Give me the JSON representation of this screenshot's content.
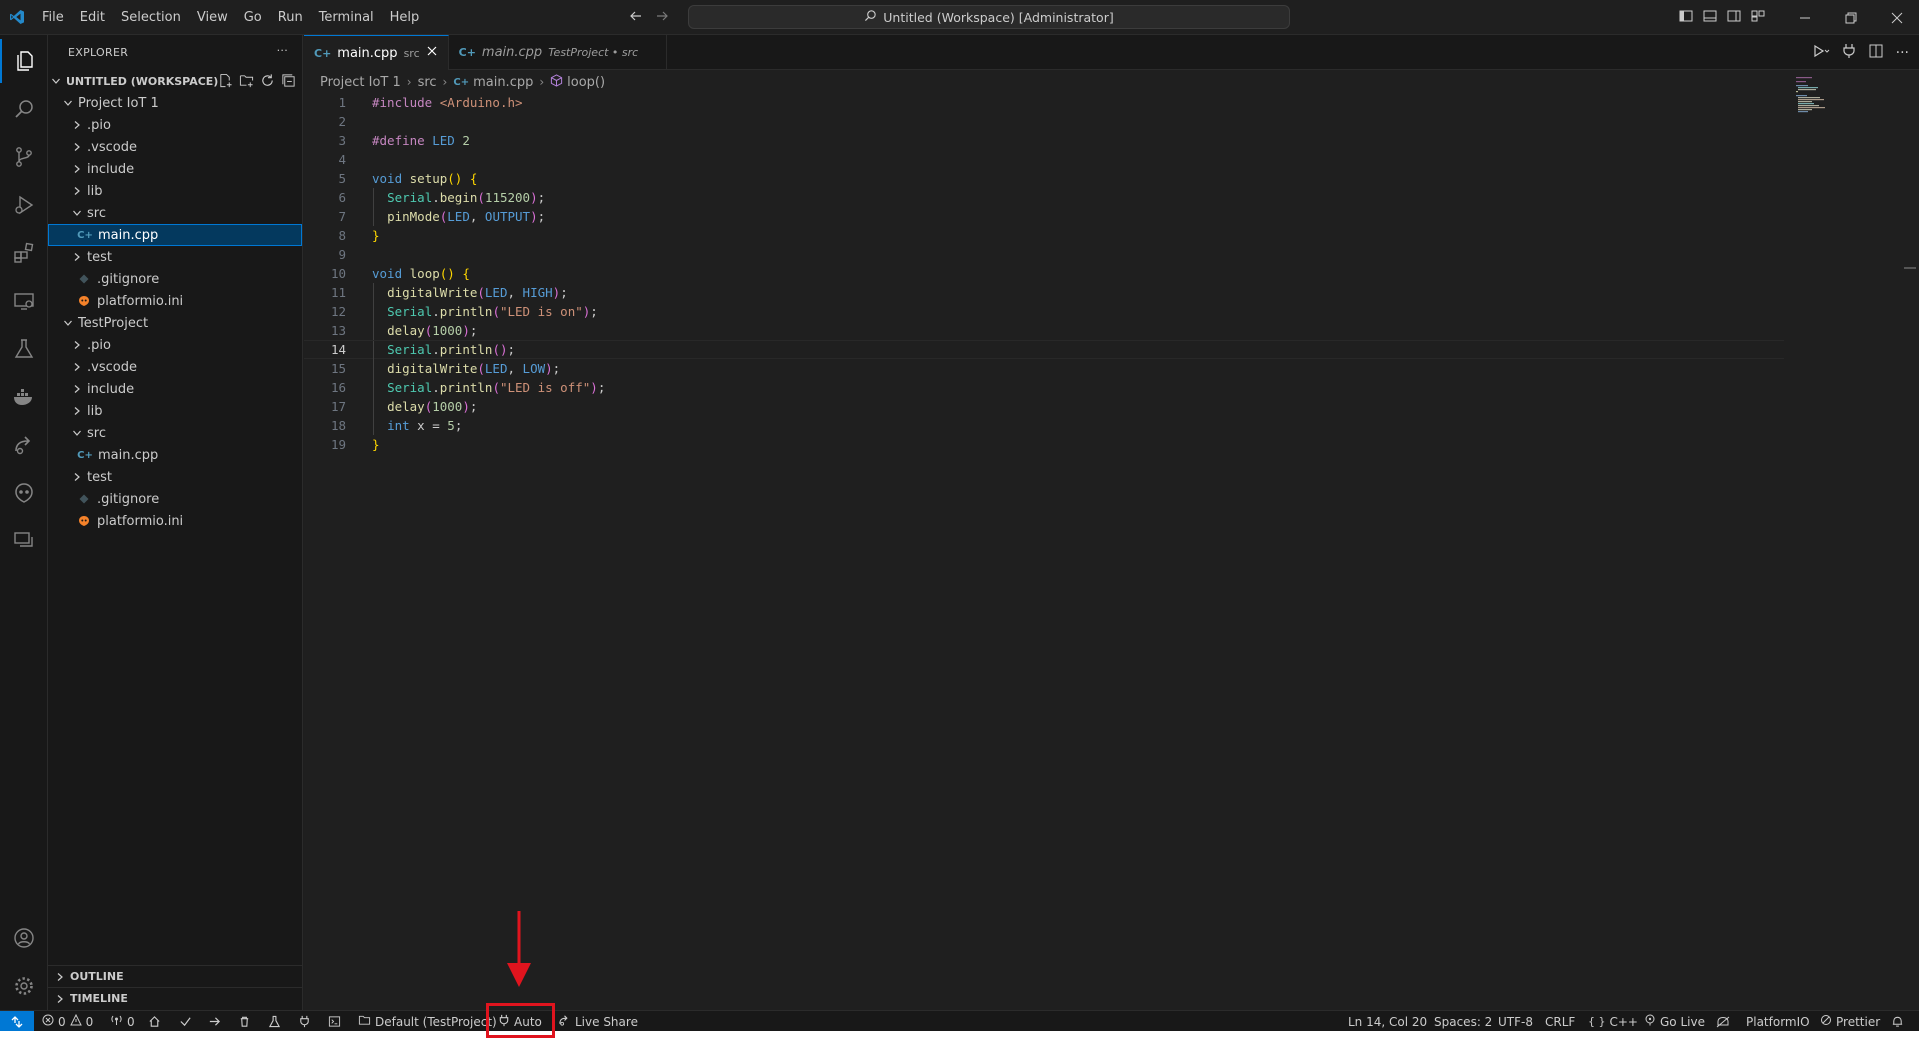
{
  "titlebar": {
    "menu": [
      "File",
      "Edit",
      "Selection",
      "View",
      "Go",
      "Run",
      "Terminal",
      "Help"
    ],
    "command_center": "Untitled (Workspace) [Administrator]"
  },
  "sidebar": {
    "header": "EXPLORER",
    "more": "···",
    "workspace": "UNTITLED (WORKSPACE)",
    "tree": [
      {
        "label": "Project IoT 1",
        "depth": 0,
        "kind": "folder-open",
        "selected": false
      },
      {
        "label": ".pio",
        "depth": 1,
        "kind": "folder",
        "selected": false
      },
      {
        "label": ".vscode",
        "depth": 1,
        "kind": "folder",
        "selected": false
      },
      {
        "label": "include",
        "depth": 1,
        "kind": "folder",
        "selected": false
      },
      {
        "label": "lib",
        "depth": 1,
        "kind": "folder",
        "selected": false
      },
      {
        "label": "src",
        "depth": 1,
        "kind": "folder-open",
        "selected": false
      },
      {
        "label": "main.cpp",
        "depth": 2,
        "kind": "cpp",
        "selected": true
      },
      {
        "label": "test",
        "depth": 1,
        "kind": "folder",
        "selected": false
      },
      {
        "label": ".gitignore",
        "depth": 1,
        "kind": "gitignore",
        "selected": false
      },
      {
        "label": "platformio.ini",
        "depth": 1,
        "kind": "platformio",
        "selected": false
      },
      {
        "label": "TestProject",
        "depth": 0,
        "kind": "folder-open",
        "selected": false
      },
      {
        "label": ".pio",
        "depth": 1,
        "kind": "folder",
        "selected": false
      },
      {
        "label": ".vscode",
        "depth": 1,
        "kind": "folder",
        "selected": false
      },
      {
        "label": "include",
        "depth": 1,
        "kind": "folder",
        "selected": false
      },
      {
        "label": "lib",
        "depth": 1,
        "kind": "folder",
        "selected": false
      },
      {
        "label": "src",
        "depth": 1,
        "kind": "folder-open",
        "selected": false
      },
      {
        "label": "main.cpp",
        "depth": 2,
        "kind": "cpp",
        "selected": false
      },
      {
        "label": "test",
        "depth": 1,
        "kind": "folder",
        "selected": false
      },
      {
        "label": ".gitignore",
        "depth": 1,
        "kind": "gitignore",
        "selected": false
      },
      {
        "label": "platformio.ini",
        "depth": 1,
        "kind": "platformio",
        "selected": false
      }
    ],
    "outline": "OUTLINE",
    "timeline": "TIMELINE"
  },
  "tabs": [
    {
      "label": "main.cpp",
      "desc": "src",
      "active": true
    },
    {
      "label": "main.cpp",
      "desc": "TestProject • src",
      "active": false
    }
  ],
  "breadcrumbs": [
    "Project IoT 1",
    "src",
    "main.cpp",
    "loop()"
  ],
  "editor": {
    "current_line": 14,
    "lines": [
      [
        [
          "#include",
          "pre"
        ],
        [
          " ",
          "txt"
        ],
        [
          "<Arduino.h>",
          "str"
        ]
      ],
      [],
      [
        [
          "#define",
          "pre"
        ],
        [
          " ",
          "txt"
        ],
        [
          "LED",
          "macro"
        ],
        [
          " ",
          "txt"
        ],
        [
          "2",
          "num"
        ]
      ],
      [],
      [
        [
          "void",
          "kw"
        ],
        [
          " ",
          "txt"
        ],
        [
          "setup",
          "fn"
        ],
        [
          "()",
          "br1"
        ],
        [
          " ",
          "txt"
        ],
        [
          "{",
          "br1"
        ]
      ],
      [
        [
          "  ",
          "txt"
        ],
        [
          "Serial",
          "obj"
        ],
        [
          ".",
          "txt"
        ],
        [
          "begin",
          "fn"
        ],
        [
          "(",
          "br2"
        ],
        [
          "115200",
          "num"
        ],
        [
          ")",
          "br2"
        ],
        [
          ";",
          "txt"
        ]
      ],
      [
        [
          "  ",
          "txt"
        ],
        [
          "pinMode",
          "fn"
        ],
        [
          "(",
          "br2"
        ],
        [
          "LED",
          "macro"
        ],
        [
          ", ",
          "txt"
        ],
        [
          "OUTPUT",
          "macro"
        ],
        [
          ")",
          "br2"
        ],
        [
          ";",
          "txt"
        ]
      ],
      [
        [
          "}",
          "br1"
        ]
      ],
      [],
      [
        [
          "void",
          "kw"
        ],
        [
          " ",
          "txt"
        ],
        [
          "loop",
          "fn"
        ],
        [
          "()",
          "br1"
        ],
        [
          " ",
          "txt"
        ],
        [
          "{",
          "br1"
        ]
      ],
      [
        [
          "  ",
          "txt"
        ],
        [
          "digitalWrite",
          "fn"
        ],
        [
          "(",
          "br2"
        ],
        [
          "LED",
          "macro"
        ],
        [
          ", ",
          "txt"
        ],
        [
          "HIGH",
          "macro"
        ],
        [
          ")",
          "br2"
        ],
        [
          ";",
          "txt"
        ]
      ],
      [
        [
          "  ",
          "txt"
        ],
        [
          "Serial",
          "obj"
        ],
        [
          ".",
          "txt"
        ],
        [
          "println",
          "fn"
        ],
        [
          "(",
          "br2"
        ],
        [
          "\"LED is on\"",
          "str"
        ],
        [
          ")",
          "br2"
        ],
        [
          ";",
          "txt"
        ]
      ],
      [
        [
          "  ",
          "txt"
        ],
        [
          "delay",
          "fn"
        ],
        [
          "(",
          "br2"
        ],
        [
          "1000",
          "num"
        ],
        [
          ")",
          "br2"
        ],
        [
          ";",
          "txt"
        ]
      ],
      [
        [
          "  ",
          "txt"
        ],
        [
          "Serial",
          "obj"
        ],
        [
          ".",
          "txt"
        ],
        [
          "println",
          "fn"
        ],
        [
          "()",
          "br2"
        ],
        [
          ";",
          "txt"
        ]
      ],
      [
        [
          "  ",
          "txt"
        ],
        [
          "digitalWrite",
          "fn"
        ],
        [
          "(",
          "br2"
        ],
        [
          "LED",
          "macro"
        ],
        [
          ", ",
          "txt"
        ],
        [
          "LOW",
          "macro"
        ],
        [
          ")",
          "br2"
        ],
        [
          ";",
          "txt"
        ]
      ],
      [
        [
          "  ",
          "txt"
        ],
        [
          "Serial",
          "obj"
        ],
        [
          ".",
          "txt"
        ],
        [
          "println",
          "fn"
        ],
        [
          "(",
          "br2"
        ],
        [
          "\"LED is off\"",
          "str"
        ],
        [
          ")",
          "br2"
        ],
        [
          ";",
          "txt"
        ]
      ],
      [
        [
          "  ",
          "txt"
        ],
        [
          "delay",
          "fn"
        ],
        [
          "(",
          "br2"
        ],
        [
          "1000",
          "num"
        ],
        [
          ")",
          "br2"
        ],
        [
          ";",
          "txt"
        ]
      ],
      [
        [
          "  ",
          "txt"
        ],
        [
          "int",
          "kw"
        ],
        [
          " x = ",
          "txt"
        ],
        [
          "5",
          "num"
        ],
        [
          ";",
          "txt"
        ]
      ],
      [
        [
          "}",
          "br1"
        ]
      ]
    ]
  },
  "statusbar": {
    "errors": "0",
    "warnings": "0",
    "ports": "0",
    "env": "Default (TestProject)",
    "auto": "Auto",
    "liveshare": "Live Share",
    "position": "Ln 14, Col 20",
    "spaces": "Spaces: 2",
    "encoding": "UTF-8",
    "eol": "CRLF",
    "language": "C++",
    "golive": "Go Live",
    "platformio": "PlatformIO",
    "prettier": "Prettier"
  },
  "colors": {
    "accent": "#0078d4",
    "annotation": "#e0141e",
    "background": "#1e1e1e"
  }
}
